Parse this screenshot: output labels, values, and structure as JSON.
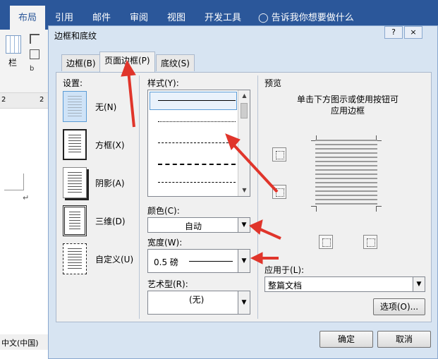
{
  "ribbon": {
    "tabs": [
      "布局",
      "引用",
      "邮件",
      "审阅",
      "视图",
      "开发工具"
    ],
    "tell_me": "告诉我你想要做什么",
    "left_col_label": "栏",
    "ruler_marks": [
      "2",
      "2"
    ]
  },
  "status_bar": {
    "language": "中文(中国)"
  },
  "dialog": {
    "title": "边框和底纹",
    "help": "?",
    "close": "×",
    "tabs": [
      "边框(B)",
      "页面边框(P)",
      "底纹(S)"
    ],
    "settings_label": "设置:",
    "settings": [
      "无(N)",
      "方框(X)",
      "阴影(A)",
      "三维(D)",
      "自定义(U)"
    ],
    "style_label": "样式(Y):",
    "color_label": "颜色(C):",
    "color_value": "自动",
    "width_label": "宽度(W):",
    "width_value": "0.5 磅",
    "art_label": "艺术型(R):",
    "art_value": "(无)",
    "preview_label": "预览",
    "preview_hint_1": "单击下方图示或使用按钮可",
    "preview_hint_2": "应用边框",
    "apply_label": "应用于(L):",
    "apply_value": "整篇文档",
    "options_button": "选项(O)...",
    "ok_button": "确定",
    "cancel_button": "取消"
  },
  "colors": {
    "ribbon_blue": "#2b579a",
    "arrow_red": "#e0352b",
    "dialog_frame": "#d7e4f2"
  }
}
